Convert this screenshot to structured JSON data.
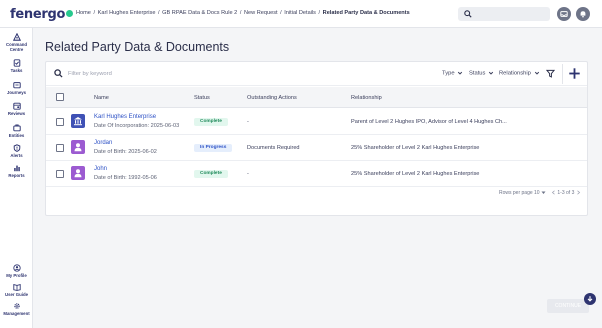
{
  "app": {
    "brand": "fenergo"
  },
  "breadcrumb": {
    "items": [
      "Home",
      "Karl Hughes Enterprise",
      "GB RPAE Data & Docs Rule 2",
      "New Request",
      "Initial Details"
    ],
    "current": "Related Party Data & Documents",
    "separator": "/"
  },
  "sidebar": {
    "top": [
      {
        "label": "Command Centre",
        "icon": "command-centre-icon"
      },
      {
        "label": "Tasks",
        "icon": "tasks-icon"
      },
      {
        "label": "Journeys",
        "icon": "journeys-icon"
      },
      {
        "label": "Reviews",
        "icon": "reviews-icon"
      },
      {
        "label": "Entities",
        "icon": "entities-icon"
      },
      {
        "label": "Alerts",
        "icon": "alerts-icon"
      },
      {
        "label": "Reports",
        "icon": "reports-icon"
      }
    ],
    "bottom": [
      {
        "label": "My Profile",
        "icon": "profile-icon"
      },
      {
        "label": "User Guide",
        "icon": "user-guide-icon"
      },
      {
        "label": "Management",
        "icon": "gear-icon"
      }
    ]
  },
  "page": {
    "title": "Related Party Data & Documents"
  },
  "filters": {
    "search_placeholder": "Filter by keyword",
    "type_label": "Type",
    "status_label": "Status",
    "relationship_label": "Relationship"
  },
  "table": {
    "headers": {
      "name": "Name",
      "status": "Status",
      "outstanding": "Outstanding Actions",
      "relationship": "Relationship"
    },
    "rows": [
      {
        "name": "Karl Hughes Enterprise",
        "sub": "Date Of Incorporation: 2025-06-03",
        "entity_type": "company",
        "status": "Complete",
        "outstanding": "-",
        "relationship": "Parent of Level 2 Hughes IPO, Advisor of Level 4 Hughes Ch..."
      },
      {
        "name": "Jordan",
        "sub": "Date of Birth: 2025-06-02",
        "entity_type": "individual",
        "status": "In Progress",
        "outstanding": "Documents Required",
        "relationship": "25% Shareholder of Level 2 Karl Hughes Enterprise"
      },
      {
        "name": "John",
        "sub": "Date of Birth: 1992-05-06",
        "entity_type": "individual",
        "status": "Complete",
        "outstanding": "-",
        "relationship": "25% Shareholder of Level 2 Karl Hughes Enterprise"
      }
    ]
  },
  "pagination": {
    "rows_per_page_label": "Rows per page",
    "rows_per_page_value": "10",
    "range": "1-3 of 3"
  },
  "footer": {
    "continue_label": "CONTINUE"
  },
  "colors": {
    "brand_navy": "#2e3470",
    "brand_green": "#27c98e",
    "link_blue": "#2e52c6",
    "company_icon_bg": "#3f51b5",
    "individual_icon_bg": "#9c5bd1",
    "complete_bg": "#e2f7ee",
    "complete_text": "#1f8a5a",
    "in_progress_bg": "#e5eefc",
    "in_progress_text": "#2e52c6"
  }
}
